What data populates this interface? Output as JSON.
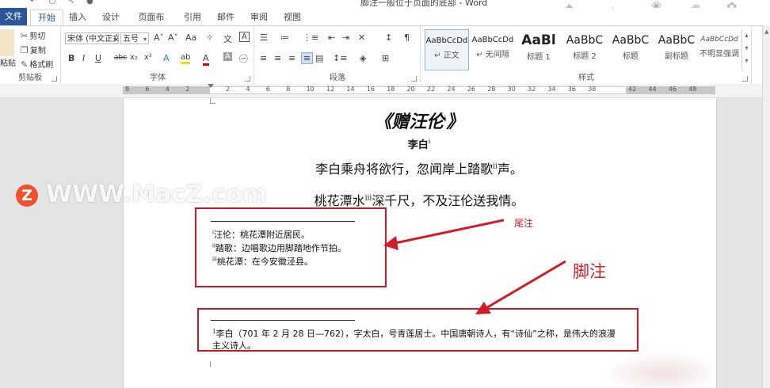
{
  "window": {
    "title": "脚注一般位于页面的底部 - Word"
  },
  "tabs": [
    {
      "label": "文件"
    },
    {
      "label": "开始"
    },
    {
      "label": "插入"
    },
    {
      "label": "设计"
    },
    {
      "label": "页面布局"
    },
    {
      "label": "引用"
    },
    {
      "label": "邮件"
    },
    {
      "label": "审阅"
    },
    {
      "label": "视图"
    }
  ],
  "ribbon": {
    "clipboard": {
      "label": "剪贴板",
      "paste": "粘贴",
      "cut": "剪切",
      "copy": "复制",
      "format_painter": "格式刷"
    },
    "font": {
      "label": "字体",
      "font_name": "宋体 (中文正文)",
      "font_size": "五号",
      "bold": "B",
      "italic": "I",
      "underline": "U",
      "strike": "abc",
      "subscript": "x₂",
      "superscript": "x²",
      "grow": "A˄",
      "shrink": "A˅",
      "case": "Aa",
      "clear": "A",
      "text_effects": "A",
      "highlight": "ab",
      "font_color": "A",
      "char_shade": "A"
    },
    "paragraph": {
      "label": "段落"
    },
    "styles": {
      "label": "样式",
      "items": [
        {
          "sample": "AaBbCcDd",
          "name": "↵ 正文"
        },
        {
          "sample": "AaBbCcDd",
          "name": "↵ 无间隔"
        },
        {
          "sample": "AaBl",
          "name": "标题 1"
        },
        {
          "sample": "AaBbC",
          "name": "标题 2"
        },
        {
          "sample": "AaBbC",
          "name": "标题"
        },
        {
          "sample": "AaBbC",
          "name": "副标题"
        },
        {
          "sample": "AaBbCcDd",
          "name": "不明显强调"
        }
      ]
    }
  },
  "ruler": {
    "numbers": [
      "8",
      "6",
      "4",
      "2",
      "",
      "2",
      "4",
      "6",
      "8",
      "10",
      "12",
      "14",
      "16",
      "18",
      "20",
      "22",
      "24",
      "26",
      "28",
      "30",
      "32",
      "34",
      "36",
      "38",
      "",
      "42",
      "44",
      "46",
      "48"
    ]
  },
  "document": {
    "title": "《赠汪伦",
    "title_mark": "i",
    "title_end": "》",
    "author": "李白",
    "author_mark": "i",
    "line1": "李白乘舟将欲行，忽闻岸上踏歌",
    "line1_mark": "ii",
    "line1_end": "声。",
    "line2": "桃花潭水",
    "line2_mark": "iii",
    "line2_end": "深千尺，不及汪伦送我情。"
  },
  "endnotes": [
    {
      "mark": "i",
      "text": "汪伦：桃花潭附近居民。"
    },
    {
      "mark": "ii",
      "text": "踏歌：边唱歌边用脚踏地作节拍。"
    },
    {
      "mark": "iii",
      "text": "桃花潭：在今安徽泾县。"
    }
  ],
  "footnote": {
    "mark": "1",
    "line1": "李白（701 年 2 月 28 日—762），字太白，号青莲居士。中国唐朝诗人，有“诗仙”之称，是伟大的浪漫",
    "line2": "主义诗人。"
  },
  "annotations": {
    "endnote_label": "尾注",
    "footnote_label": "脚注",
    "color": "#d11d2a"
  },
  "watermark": {
    "logo": "Z",
    "text": "WWW.MacZ.com"
  }
}
